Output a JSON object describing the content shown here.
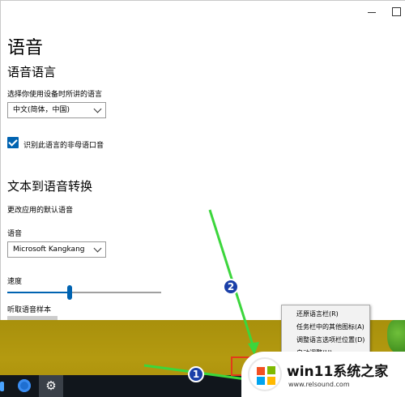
{
  "settings": {
    "page_title": "语音",
    "speech_language": {
      "heading": "语音语言",
      "select_label": "选择你使用设备时所讲的语言",
      "selected_language": "中文(简体，中国)",
      "checkbox_label": "识别此语言的非母语口音",
      "checkbox_checked": true
    },
    "tts": {
      "heading": "文本到语音转换",
      "description": "更改应用的默认语音",
      "voice_label": "语音",
      "selected_voice": "Microsoft Kangkang",
      "speed_label": "速度",
      "speed_value": 0.4,
      "preview_label": "听取语音样本"
    }
  },
  "context_menu": {
    "items": [
      "还原语言栏(R)",
      "任务栏中的其他图标(A)",
      "调整语言选项栏位置(D)",
      "自动调整(U)"
    ]
  },
  "annotations": {
    "step1": "1",
    "step2": "2",
    "arrow_color": "#3cd63c",
    "highlight_color": "#e23b1a"
  },
  "taskbar": {
    "icons": [
      "edge-icon",
      "store-icon",
      "settings-gear-icon"
    ],
    "settings_glyph": "⚙"
  },
  "watermark": {
    "title": "win11系统之家",
    "url": "www.relsound.com"
  }
}
